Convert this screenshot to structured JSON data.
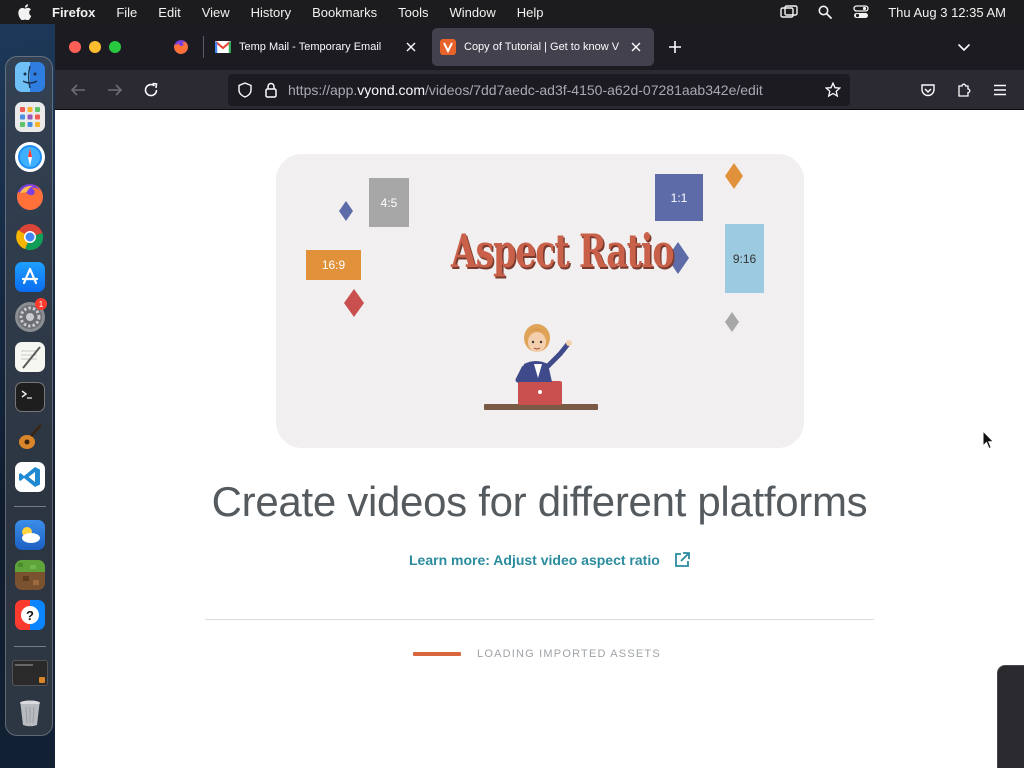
{
  "menubar": {
    "app_name": "Firefox",
    "menus": [
      "File",
      "Edit",
      "View",
      "History",
      "Bookmarks",
      "Tools",
      "Window",
      "Help"
    ],
    "clock": "Thu Aug 3  12:35 AM",
    "status_icons": [
      "screen-mirroring-icon",
      "spotlight-search-icon",
      "control-center-icon"
    ]
  },
  "dock": {
    "apps": [
      {
        "name": "Finder",
        "icon": "finder-icon"
      },
      {
        "name": "Launchpad",
        "icon": "launchpad-icon"
      },
      {
        "name": "Safari",
        "icon": "safari-icon"
      },
      {
        "name": "Firefox",
        "icon": "firefox-icon"
      },
      {
        "name": "Chrome",
        "icon": "chrome-icon"
      },
      {
        "name": "App Store",
        "icon": "app-store-icon"
      },
      {
        "name": "System Settings",
        "icon": "system-settings-icon",
        "badge": "1"
      },
      {
        "name": "TextEdit",
        "icon": "textedit-icon"
      },
      {
        "name": "Terminal",
        "icon": "terminal-icon"
      },
      {
        "name": "GarageBand",
        "icon": "garageband-icon"
      },
      {
        "name": "Visual Studio Code",
        "icon": "vscode-icon"
      },
      {
        "name": "Weather",
        "icon": "weather-icon"
      },
      {
        "name": "Minecraft",
        "icon": "minecraft-icon"
      },
      {
        "name": "Help",
        "icon": "help-icon"
      },
      {
        "name": "Recent Window",
        "icon": "window-thumbnail-icon"
      },
      {
        "name": "Trash",
        "icon": "trash-icon"
      }
    ]
  },
  "browser": {
    "tabs": [
      {
        "title": "",
        "favicon": "firefox-icon",
        "pinned": true
      },
      {
        "title": "Temp Mail - Temporary Email",
        "favicon": "gmail-icon"
      },
      {
        "title": "Copy of Tutorial | Get to know V",
        "favicon": "vyond-icon",
        "active": true
      }
    ],
    "url_prefix": "https://app.",
    "url_domain": "vyond.com",
    "url_path": "/videos/7dd7aedc-ad3f-4150-a62d-07281aab342e/edit"
  },
  "page": {
    "hero": {
      "title": "Aspect Ratio",
      "ratios": [
        "4:5",
        "1:1",
        "16:9",
        "9:16"
      ],
      "colors": {
        "blue": "#5d6ba8",
        "orange": "#e0913a",
        "grey": "#a7a7a7",
        "light_blue": "#9ccbe1",
        "red": "#c9604a"
      }
    },
    "headline": "Create videos for different platforms",
    "learn_more": "Learn more: Adjust video aspect ratio",
    "loading_label": "LOADING IMPORTED ASSETS",
    "accent_color": "#d9663e",
    "link_color": "#2a8c9e"
  }
}
